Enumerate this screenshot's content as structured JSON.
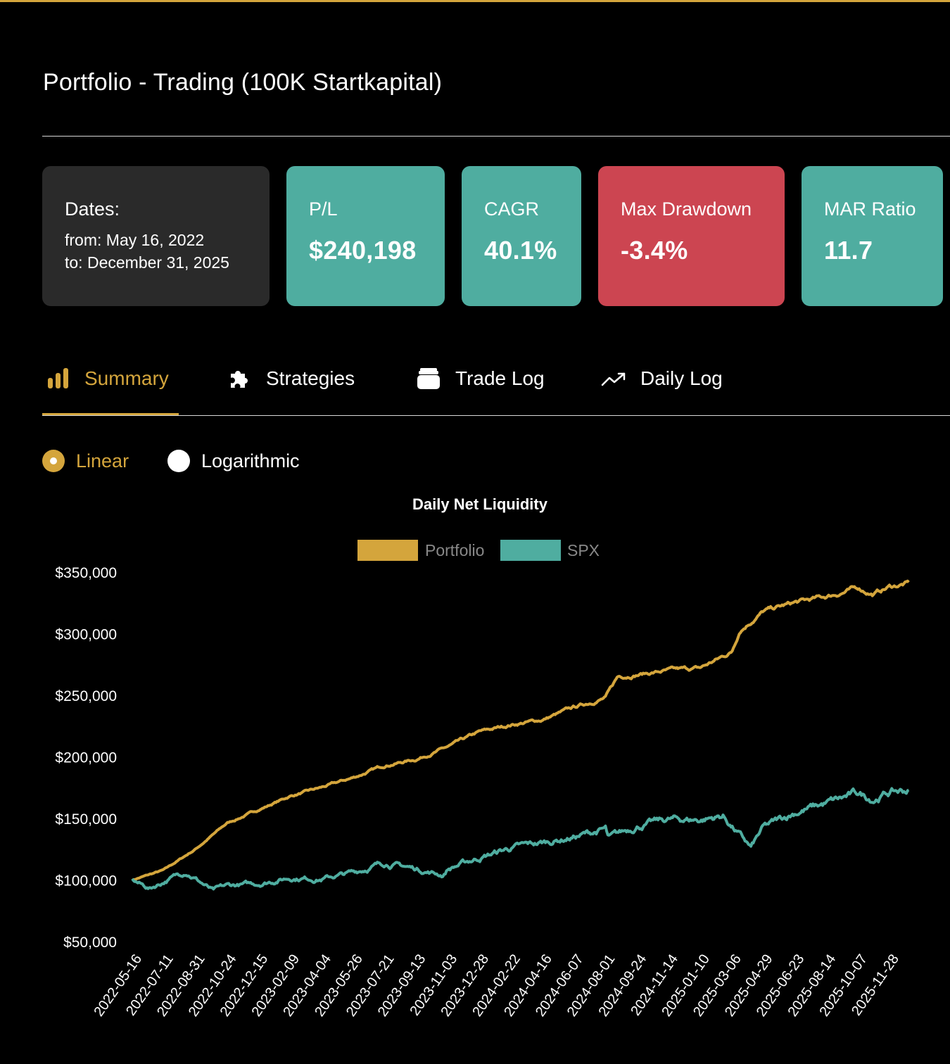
{
  "header": {
    "title": "Portfolio - Trading (100K Startkapital)"
  },
  "cards": {
    "dates": {
      "label": "Dates:",
      "from": "from: May 16, 2022",
      "to": "to: December 31, 2025"
    },
    "pl": {
      "label": "P/L",
      "value": "$240,198"
    },
    "cagr": {
      "label": "CAGR",
      "value": "40.1%"
    },
    "drawdown": {
      "label": "Max Drawdown",
      "value": "-3.4%"
    },
    "mar": {
      "label": "MAR Ratio",
      "value": "11.7"
    }
  },
  "tabs": [
    {
      "label": "Summary",
      "icon": "bar-chart-icon",
      "active": true
    },
    {
      "label": "Strategies",
      "icon": "puzzle-icon",
      "active": false
    },
    {
      "label": "Trade Log",
      "icon": "wallet-icon",
      "active": false
    },
    {
      "label": "Daily Log",
      "icon": "trend-arrow-icon",
      "active": false
    }
  ],
  "scale_options": [
    {
      "label": "Linear",
      "selected": true
    },
    {
      "label": "Logarithmic",
      "selected": false
    }
  ],
  "colors": {
    "accent": "#d4a53c",
    "teal": "#4fada0",
    "red": "#cc4551",
    "card_dark": "#2a2a2a"
  },
  "chart_data": {
    "type": "line",
    "title": "Daily Net Liquidity",
    "x_tick_labels": [
      "2022-05-16",
      "2022-07-11",
      "2022-08-31",
      "2022-10-24",
      "2022-12-15",
      "2023-02-09",
      "2023-04-04",
      "2023-05-26",
      "2023-07-21",
      "2023-09-13",
      "2023-11-03",
      "2023-12-28",
      "2024-02-22",
      "2024-04-16",
      "2024-06-07",
      "2024-08-01",
      "2024-09-24",
      "2024-11-14",
      "2025-01-10",
      "2025-03-06",
      "2025-04-29",
      "2025-06-23",
      "2025-08-14",
      "2025-10-07",
      "2025-11-28"
    ],
    "y_tick_labels": [
      "$350,000",
      "$300,000",
      "$250,000",
      "$200,000",
      "$150,000",
      "$100,000",
      "$50,000"
    ],
    "y_ticks": [
      350000,
      300000,
      250000,
      200000,
      150000,
      100000,
      50000
    ],
    "ylim": [
      50000,
      350000
    ],
    "legend_position": "top",
    "series": [
      {
        "name": "Portfolio",
        "color": "#d4a53c",
        "x": [
          "2022-05-16",
          "2022-07-11",
          "2022-08-31",
          "2022-10-24",
          "2022-12-15",
          "2023-02-09",
          "2023-04-04",
          "2023-05-26",
          "2023-07-21",
          "2023-09-13",
          "2023-11-03",
          "2023-12-28",
          "2024-02-22",
          "2024-04-16",
          "2024-06-07",
          "2024-08-01",
          "2024-08-22",
          "2024-09-24",
          "2024-11-14",
          "2025-01-10",
          "2025-03-06",
          "2025-03-20",
          "2025-04-29",
          "2025-06-23",
          "2025-08-14",
          "2025-10-07",
          "2025-11-01",
          "2025-11-28",
          "2025-12-31"
        ],
        "values": [
          100000,
          108000,
          125000,
          146000,
          157000,
          168000,
          175000,
          183000,
          193000,
          198000,
          208000,
          220000,
          226000,
          230000,
          240000,
          248000,
          265000,
          267000,
          270000,
          272000,
          285000,
          303000,
          318000,
          325000,
          330000,
          337000,
          332000,
          338000,
          341000
        ]
      },
      {
        "name": "SPX",
        "color": "#4fada0",
        "x": [
          "2022-05-16",
          "2022-06-16",
          "2022-08-16",
          "2022-09-30",
          "2022-10-24",
          "2022-12-15",
          "2023-02-09",
          "2023-04-04",
          "2023-05-26",
          "2023-07-21",
          "2023-09-13",
          "2023-10-27",
          "2023-11-03",
          "2023-12-28",
          "2024-02-22",
          "2024-04-16",
          "2024-06-07",
          "2024-08-01",
          "2024-08-06",
          "2024-09-24",
          "2024-11-14",
          "2025-01-10",
          "2025-02-19",
          "2025-04-08",
          "2025-04-29",
          "2025-06-23",
          "2025-08-14",
          "2025-10-07",
          "2025-11-01",
          "2025-11-28",
          "2025-12-31"
        ],
        "values": [
          100000,
          93000,
          107000,
          91000,
          95000,
          97000,
          102000,
          101000,
          106000,
          114000,
          109000,
          104000,
          109000,
          118000,
          126000,
          130000,
          135000,
          141000,
          133000,
          144000,
          149000,
          149000,
          152000,
          126000,
          142000,
          155000,
          162000,
          170000,
          166000,
          171000,
          173000
        ]
      }
    ]
  }
}
